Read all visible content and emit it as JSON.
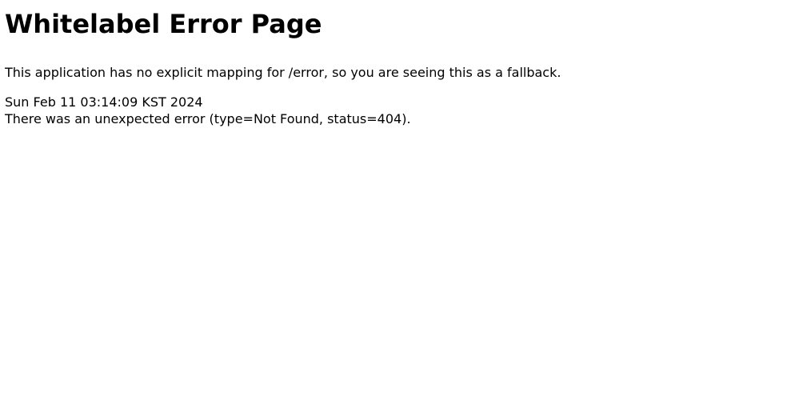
{
  "page": {
    "title": "Whitelabel Error Page",
    "message": "This application has no explicit mapping for /error, so you are seeing this as a fallback.",
    "timestamp": "Sun Feb 11 03:14:09 KST 2024",
    "error_detail": "There was an unexpected error (type=Not Found, status=404)."
  },
  "colors": {
    "background": "#ffffff",
    "text": "#000000"
  }
}
